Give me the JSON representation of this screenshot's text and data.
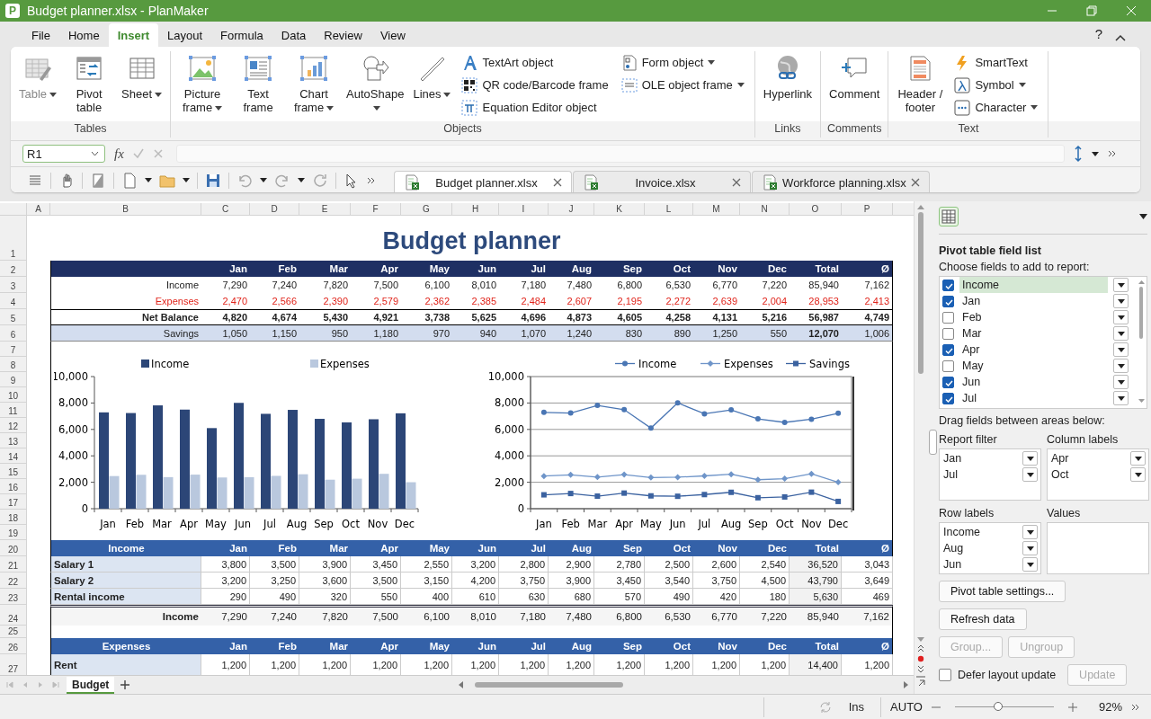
{
  "window": {
    "title": "Budget planner.xlsx - PlanMaker",
    "logo_text": "P"
  },
  "menu_tabs": [
    {
      "label": "File",
      "selected": false
    },
    {
      "label": "Home",
      "selected": false
    },
    {
      "label": "Insert",
      "selected": true
    },
    {
      "label": "Layout",
      "selected": false
    },
    {
      "label": "Formula",
      "selected": false
    },
    {
      "label": "Data",
      "selected": false
    },
    {
      "label": "Review",
      "selected": false
    },
    {
      "label": "View",
      "selected": false
    }
  ],
  "help": "?",
  "ribbon": {
    "groups": [
      {
        "label": "Tables",
        "items": [
          {
            "label": "Table",
            "kind": "table",
            "disabled": true,
            "dropdown": true
          },
          {
            "label": "Pivot table",
            "kind": "pivot",
            "disabled": false,
            "dropdown": false
          },
          {
            "label": "Sheet",
            "kind": "sheet",
            "disabled": false,
            "dropdown": true
          }
        ]
      },
      {
        "label": "Objects",
        "items": [
          {
            "label": "Picture frame",
            "kind": "picture",
            "disabled": false,
            "dropdown": true
          },
          {
            "label": "Text frame",
            "kind": "textframe",
            "disabled": false,
            "dropdown": false
          },
          {
            "label": "Chart frame",
            "kind": "chart",
            "disabled": false,
            "dropdown": true
          },
          {
            "label": "AutoShape",
            "kind": "autoshape",
            "disabled": false,
            "dropdown": true
          },
          {
            "label": "Lines",
            "kind": "lines",
            "disabled": false,
            "dropdown": true
          }
        ],
        "small_items": [
          {
            "label": "TextArt object",
            "kind": "textart",
            "disabled": false,
            "dropdown": false
          },
          {
            "label": "QR code/Barcode frame",
            "kind": "qrcode",
            "disabled": false,
            "dropdown": false
          },
          {
            "label": "Equation Editor object",
            "kind": "equation",
            "disabled": false,
            "dropdown": false
          },
          {
            "label": "Form object",
            "kind": "form",
            "disabled": false,
            "dropdown": true
          },
          {
            "label": "OLE object frame",
            "kind": "ole",
            "disabled": false,
            "dropdown": true
          }
        ]
      },
      {
        "label": "Links",
        "items": [
          {
            "label": "Hyperlink",
            "kind": "hyperlink",
            "disabled": false,
            "dropdown": false
          }
        ]
      },
      {
        "label": "Comments",
        "items": [
          {
            "label": "Comment",
            "kind": "comment",
            "disabled": false,
            "dropdown": false
          }
        ]
      },
      {
        "label": "Text",
        "items": [
          {
            "label": "Header / footer",
            "kind": "headerfooter",
            "disabled": false,
            "dropdown": false
          }
        ],
        "small_items": [
          {
            "label": "SmartText",
            "kind": "smarttext",
            "disabled": false,
            "dropdown": false
          },
          {
            "label": "Symbol",
            "kind": "symbol",
            "disabled": false,
            "dropdown": true
          },
          {
            "label": "Character",
            "kind": "character",
            "disabled": false,
            "dropdown": true
          }
        ]
      }
    ]
  },
  "formula_bar": {
    "cell_ref": "R1",
    "function_label": "fx"
  },
  "doc_tabs": [
    {
      "label": "Budget planner.xlsx",
      "selected": true
    },
    {
      "label": "Invoice.xlsx",
      "selected": false
    },
    {
      "label": "Workforce planning.xlsx",
      "selected": false
    }
  ],
  "sheet": {
    "column_headers": [
      "A",
      "B",
      "C",
      "D",
      "E",
      "F",
      "G",
      "H",
      "I",
      "J",
      "K",
      "L",
      "M",
      "N",
      "O",
      "P"
    ],
    "row_numbers": [
      "1",
      "2",
      "3",
      "4",
      "5",
      "6",
      "7",
      "8",
      "9",
      "10",
      "11",
      "12",
      "13",
      "14",
      "15",
      "16",
      "17",
      "18",
      "19",
      "20",
      "21",
      "22",
      "23",
      "24",
      "25",
      "26",
      "27"
    ],
    "title": "Budget planner",
    "summary": {
      "columns": [
        "Jan",
        "Feb",
        "Mar",
        "Apr",
        "May",
        "Jun",
        "Jul",
        "Aug",
        "Sep",
        "Oct",
        "Nov",
        "Dec",
        "Total",
        "Ø"
      ],
      "rows": [
        {
          "label": "Income",
          "kind": "plain",
          "values": [
            "7,290",
            "7,240",
            "7,820",
            "7,500",
            "6,100",
            "8,010",
            "7,180",
            "7,480",
            "6,800",
            "6,530",
            "6,770",
            "7,220",
            "85,940",
            "7,162"
          ]
        },
        {
          "label": "Expenses",
          "kind": "negative",
          "values": [
            "2,470",
            "2,566",
            "2,390",
            "2,579",
            "2,362",
            "2,385",
            "2,484",
            "2,607",
            "2,195",
            "2,272",
            "2,639",
            "2,004",
            "28,953",
            "2,413"
          ]
        },
        {
          "label": "Net Balance",
          "kind": "balance",
          "values": [
            "4,820",
            "4,674",
            "5,430",
            "4,921",
            "3,738",
            "5,625",
            "4,696",
            "4,873",
            "4,605",
            "4,258",
            "4,131",
            "5,216",
            "56,987",
            "4,749"
          ]
        },
        {
          "label": "Savings",
          "kind": "savings",
          "values": [
            "1,050",
            "1,150",
            "950",
            "1,180",
            "970",
            "940",
            "1,070",
            "1,240",
            "830",
            "890",
            "1,250",
            "550",
            "12,070",
            "1,006"
          ]
        }
      ]
    },
    "bar_chart": {
      "chart_data": {
        "type": "bar",
        "legend": true,
        "categories": [
          "Jan",
          "Feb",
          "Mar",
          "Apr",
          "May",
          "Jun",
          "Jul",
          "Aug",
          "Sep",
          "Oct",
          "Nov",
          "Dec"
        ],
        "ylim": [
          0,
          10000
        ],
        "yticks": [
          {
            "value": 0,
            "label": "0"
          },
          {
            "value": 2000,
            "label": "2,000"
          },
          {
            "value": 4000,
            "label": "4,000"
          },
          {
            "value": 6000,
            "label": "6,000"
          },
          {
            "value": 8000,
            "label": "8,000"
          },
          {
            "value": 10000,
            "label": "10,000"
          }
        ],
        "series": [
          {
            "name": "Income",
            "color": "#2c4677",
            "values": [
              7290,
              7240,
              7820,
              7500,
              6100,
              8010,
              7180,
              7480,
              6800,
              6530,
              6770,
              7220
            ]
          },
          {
            "name": "Expenses",
            "color": "#b9c8de",
            "values": [
              2470,
              2566,
              2390,
              2579,
              2362,
              2385,
              2484,
              2607,
              2195,
              2272,
              2639,
              2004
            ]
          }
        ]
      }
    },
    "line_chart": {
      "chart_data": {
        "type": "line",
        "legend": true,
        "grid": true,
        "categories": [
          "Jan",
          "Feb",
          "Mar",
          "Apr",
          "May",
          "Jun",
          "Jul",
          "Aug",
          "Sep",
          "Oct",
          "Nov",
          "Dec"
        ],
        "ylim": [
          0,
          10000
        ],
        "yticks": [
          {
            "value": 0,
            "label": "0"
          },
          {
            "value": 2000,
            "label": "2,000"
          },
          {
            "value": 4000,
            "label": "4,000"
          },
          {
            "value": 6000,
            "label": "6,000"
          },
          {
            "value": 8000,
            "label": "8,000"
          },
          {
            "value": 10000,
            "label": "10,000"
          }
        ],
        "series": [
          {
            "name": "Income",
            "color": "#4a76b4",
            "marker": "circle",
            "values": [
              7290,
              7240,
              7820,
              7500,
              6100,
              8010,
              7180,
              7480,
              6800,
              6530,
              6770,
              7220
            ]
          },
          {
            "name": "Expenses",
            "color": "#6f95c9",
            "marker": "diamond",
            "values": [
              2470,
              2566,
              2390,
              2579,
              2362,
              2385,
              2484,
              2607,
              2195,
              2272,
              2639,
              2004
            ]
          },
          {
            "name": "Savings",
            "color": "#3b62a0",
            "marker": "square",
            "values": [
              1050,
              1150,
              950,
              1180,
              970,
              940,
              1070,
              1240,
              830,
              890,
              1250,
              550
            ]
          }
        ]
      }
    },
    "income_table": {
      "header": "Income",
      "columns": [
        "Jan",
        "Feb",
        "Mar",
        "Apr",
        "May",
        "Jun",
        "Jul",
        "Aug",
        "Sep",
        "Oct",
        "Nov",
        "Dec",
        "Total",
        "Ø"
      ],
      "rows": [
        {
          "label": "Salary 1",
          "values": [
            "3,800",
            "3,500",
            "3,900",
            "3,450",
            "2,550",
            "3,200",
            "2,800",
            "2,900",
            "2,780",
            "2,500",
            "2,600",
            "2,540",
            "36,520",
            "3,043"
          ]
        },
        {
          "label": "Salary 2",
          "values": [
            "3,200",
            "3,250",
            "3,600",
            "3,500",
            "3,150",
            "4,200",
            "3,750",
            "3,900",
            "3,450",
            "3,540",
            "3,750",
            "4,500",
            "43,790",
            "3,649"
          ]
        },
        {
          "label": "Rental income",
          "values": [
            "290",
            "490",
            "320",
            "550",
            "400",
            "610",
            "630",
            "680",
            "570",
            "490",
            "420",
            "180",
            "5,630",
            "469"
          ]
        }
      ],
      "total": {
        "label": "Income",
        "values": [
          "7,290",
          "7,240",
          "7,820",
          "7,500",
          "6,100",
          "8,010",
          "7,180",
          "7,480",
          "6,800",
          "6,530",
          "6,770",
          "7,220",
          "85,940",
          "7,162"
        ]
      }
    },
    "expenses_table": {
      "header": "Expenses",
      "columns": [
        "Jan",
        "Feb",
        "Mar",
        "Apr",
        "May",
        "Jun",
        "Jul",
        "Aug",
        "Sep",
        "Oct",
        "Nov",
        "Dec",
        "Total",
        "Ø"
      ],
      "rows": [
        {
          "label": "Rent",
          "values": [
            "1,200",
            "1,200",
            "1,200",
            "1,200",
            "1,200",
            "1,200",
            "1,200",
            "1,200",
            "1,200",
            "1,200",
            "1,200",
            "1,200",
            "14,400",
            "1,200"
          ]
        }
      ]
    }
  },
  "sheet_tabs": [
    {
      "label": "Budget",
      "selected": true
    }
  ],
  "status_bar": {
    "insert_mode": "Ins",
    "calc_mode": "AUTO",
    "zoom": "92%",
    "zoom_slider": {
      "level": 0.45
    }
  },
  "panel": {
    "title": "Pivot table field list",
    "fields_label": "Choose fields to add to report:",
    "fields": [
      {
        "label": "Income",
        "checked": true,
        "selected": true
      },
      {
        "label": "Jan",
        "checked": true,
        "selected": false
      },
      {
        "label": "Feb",
        "checked": false,
        "selected": false
      },
      {
        "label": "Mar",
        "checked": false,
        "selected": false
      },
      {
        "label": "Apr",
        "checked": true,
        "selected": false
      },
      {
        "label": "May",
        "checked": false,
        "selected": false
      },
      {
        "label": "Jun",
        "checked": true,
        "selected": false
      },
      {
        "label": "Jul",
        "checked": true,
        "selected": false
      }
    ],
    "areas_label": "Drag fields between areas below:",
    "areas": [
      {
        "title": "Report filter",
        "items": [
          "Jan",
          "Jul"
        ]
      },
      {
        "title": "Column labels",
        "items": [
          "Apr",
          "Oct"
        ]
      },
      {
        "title": "Row labels",
        "items": [
          "Income",
          "Aug",
          "Jun"
        ]
      },
      {
        "title": "Values"
      }
    ],
    "button_rows": [
      [
        {
          "label": "Pivot table settings...",
          "disabled": false
        }
      ],
      [
        {
          "label": "Refresh data",
          "disabled": false
        }
      ],
      [
        {
          "label": "Group...",
          "disabled": true
        },
        {
          "label": "Ungroup",
          "disabled": true
        }
      ]
    ],
    "defer_update": {
      "label": "Defer layout update",
      "checked": false
    },
    "update_button": {
      "label": "Update",
      "disabled": true
    }
  }
}
